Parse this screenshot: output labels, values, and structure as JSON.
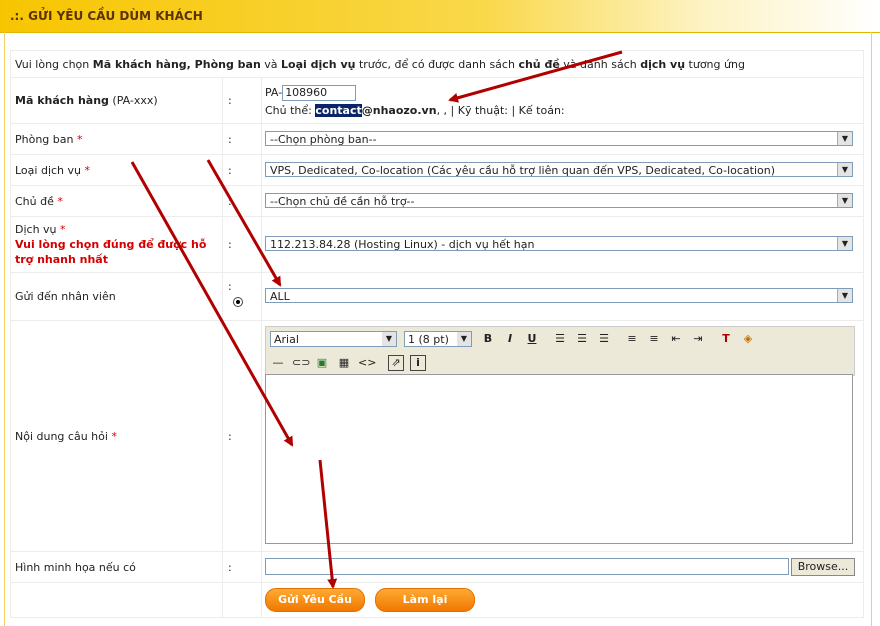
{
  "header": {
    "title": ".:. GỬI YÊU CẦU DÙM KHÁCH"
  },
  "intro": {
    "p1": "Vui lòng chọn ",
    "b1": "Mã khách hàng, Phòng ban",
    "p2": " và ",
    "b2": "Loại dịch vụ",
    "p3": " trước, để có được danh sách ",
    "b3": "chủ đề",
    "p4": " và danh sách ",
    "b4": "dịch vụ",
    "p5": " tương ứng"
  },
  "colon": ":",
  "required_mark": "*",
  "customer": {
    "label": "Mã khách hàng",
    "hint": "(PA-xxx)",
    "prefix": "PA-",
    "value": "108960",
    "owner_label": "Chủ thể:",
    "owner_highlight": "contact",
    "owner_rest": "@nhaozo.vn",
    "extra": ", , | Kỹ thuật: | Kế toán:"
  },
  "department": {
    "label": "Phòng ban",
    "selected": "--Chọn phòng ban--"
  },
  "service_type": {
    "label": "Loại dịch vụ",
    "selected": "VPS, Dedicated, Co-location (Các yêu cầu hỗ trợ liên quan đến VPS, Dedicated, Co-location)"
  },
  "topic": {
    "label": "Chủ đề",
    "selected": "--Chọn chủ đề cần hỗ trợ--"
  },
  "service": {
    "label": "Dịch vụ",
    "warning": "Vui lòng chọn đúng để được hỗ trợ nhanh nhất",
    "selected": "112.213.84.28 (Hosting Linux) - dịch vụ hết hạn"
  },
  "staff": {
    "label": "Gửi đến nhân viên",
    "selected": "ALL"
  },
  "question": {
    "label": "Nội dung câu hỏi"
  },
  "editor": {
    "font": "Arial",
    "size": "1 (8 pt)",
    "icons": [
      "bold-icon",
      "italic-icon",
      "underline-icon",
      "align-left-icon",
      "align-center-icon",
      "align-right-icon",
      "ordered-list-icon",
      "unordered-list-icon",
      "outdent-icon",
      "indent-icon",
      "text-color-icon",
      "background-color-icon",
      "horizontal-rule-icon",
      "link-icon",
      "image-icon",
      "table-icon",
      "source-code-icon",
      "fullscreen-icon",
      "info-icon"
    ]
  },
  "attachment": {
    "label": "Hình minh họa nếu có",
    "browse": "Browse..."
  },
  "buttons": {
    "submit": "Gửi Yêu Cầu",
    "reset": "Làm lại"
  },
  "colors": {
    "accent": "#f7c500",
    "button": "#f58a10",
    "arrow": "#b00000",
    "required": "#d40000"
  }
}
